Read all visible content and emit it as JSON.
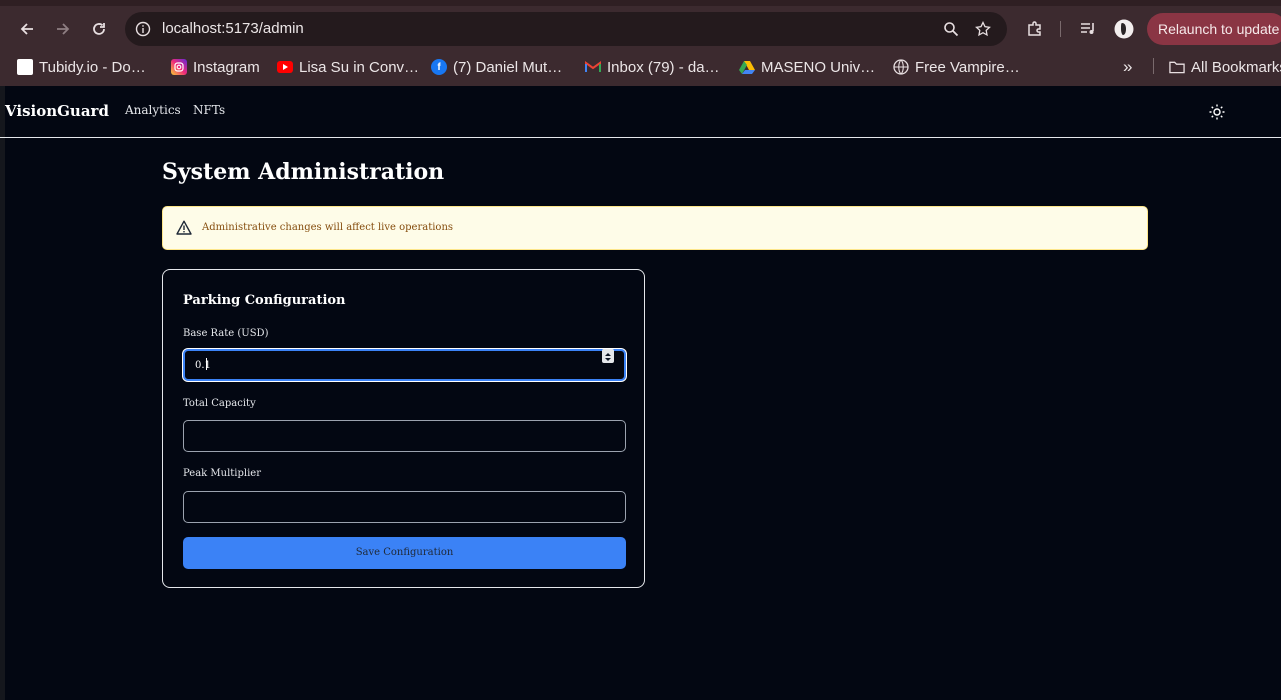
{
  "browser": {
    "url": "localhost:5173/admin",
    "relaunch_label": "Relaunch to update",
    "bookmarks": [
      {
        "label": "Tubidy.io - Do…",
        "icon": "page-icon"
      },
      {
        "label": "Instagram",
        "icon": "instagram-icon",
        "color": "#d62976"
      },
      {
        "label": "Lisa Su in Conv…",
        "icon": "youtube-icon",
        "color": "#ff0000"
      },
      {
        "label": "(7) Daniel Mut…",
        "icon": "facebook-icon",
        "color": "#1877f2"
      },
      {
        "label": "Inbox (79) - da…",
        "icon": "gmail-icon",
        "color": "#ea4335"
      },
      {
        "label": "MASENO Univ…",
        "icon": "drive-icon",
        "color": "#fbbc04"
      },
      {
        "label": "Free Vampire…",
        "icon": "globe-icon"
      }
    ],
    "all_bookmarks_label": "All Bookmarks"
  },
  "app": {
    "brand": "VisionGuard",
    "nav": {
      "analytics": "Analytics",
      "nfts": "NFTs"
    }
  },
  "page": {
    "title": "System Administration",
    "alert": "Administrative changes will affect live operations"
  },
  "form": {
    "title": "Parking Configuration",
    "base_rate_label": "Base Rate (USD)",
    "base_rate_value": "0.1",
    "capacity_label": "Total Capacity",
    "capacity_value": "",
    "peak_label": "Peak Multiplier",
    "peak_value": "",
    "save_label": "Save Configuration"
  },
  "colors": {
    "background": "#030712",
    "accent": "#3b82f6",
    "alert_bg": "#fefce8",
    "alert_text": "#854d0e",
    "chrome": "#3c2a2f",
    "relaunch": "#8a3544"
  }
}
